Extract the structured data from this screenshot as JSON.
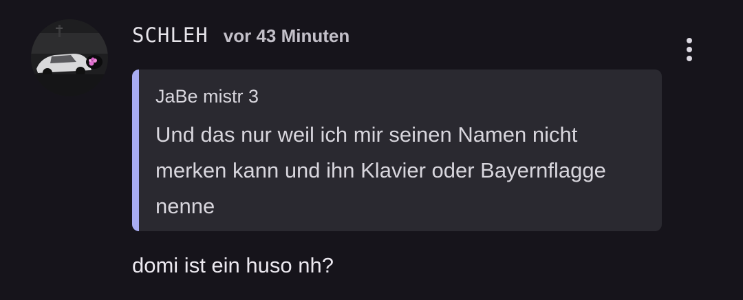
{
  "comment": {
    "author": "SCHLEH",
    "timestamp": "vor 43 Minuten",
    "avatar_icon": "profile-photo-car-flowers",
    "menu_icon": "more-vert-icon",
    "quote": {
      "author": "JaBe mistr 3",
      "text": "Und das nur weil ich mir seinen Namen nicht merken kann und ihn Klavier oder Bayernflagge nenne",
      "accent_color": "#a8acf2"
    },
    "text": "domi ist ein huso nh?"
  }
}
